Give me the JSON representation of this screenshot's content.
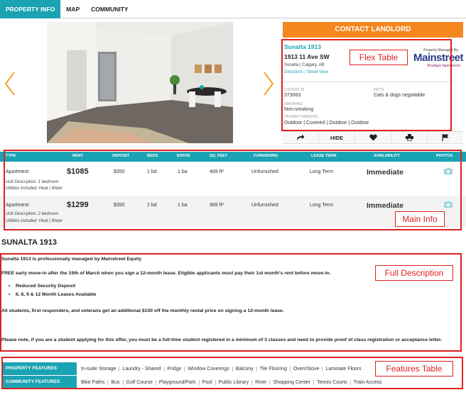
{
  "tabs": [
    {
      "label": "PROPERTY INFO",
      "active": true
    },
    {
      "label": "MAP",
      "active": false
    },
    {
      "label": "COMMUNITY",
      "active": false
    }
  ],
  "contact_button": "CONTACT LANDLORD",
  "property": {
    "name": "Sunalta 1913",
    "address": "1913 11 Ave SW",
    "city": "Sunalta | Calgary, AB",
    "links": [
      "Directions",
      "Street View"
    ],
    "managed_by_label": "Property Managed By:",
    "manager_logo_main": "Mainstreet",
    "manager_logo_sub": "Boutique Apartments"
  },
  "details": {
    "listing_id_label": "LISTING ID",
    "listing_id": "373063",
    "pets_label": "PETS",
    "pets": "Cats & dogs negotiable",
    "smoking_label": "SMOKING",
    "smoking": "Non-smoking",
    "parking_label": "TENANT PARKING",
    "parking": "Outdoor | Covered | Outdoor | Outdoor"
  },
  "actions": {
    "share": "share-icon",
    "hide": "HIDE",
    "favorite": "heart-icon",
    "print": "print-icon",
    "report": "flag-icon"
  },
  "annotations": {
    "flex": "Flex Table",
    "main": "Main Info",
    "full": "Full Description",
    "features": "Features Table"
  },
  "table": {
    "headers": [
      "TYPE",
      "RENT",
      "DEPOSIT",
      "BEDS",
      "BATHS",
      "SQ. FEET",
      "FURNISHING",
      "LEASE TERM",
      "AVAILABILITY",
      "PHOTOS"
    ],
    "rows": [
      {
        "type": "Apartment",
        "rent": "$1085",
        "deposit": "$350",
        "beds": "1 bd",
        "baths": "1 ba",
        "sqft": "489 ft²",
        "furnishing": "Unfurnished",
        "lease": "Long Term",
        "availability": "Immediate",
        "desc": "Unit Description: 1 bedroom",
        "utilities": "Utilities included: Heat | Water"
      },
      {
        "type": "Apartment",
        "rent": "$1299",
        "deposit": "$350",
        "beds": "2 bd",
        "baths": "1 ba",
        "sqft": "989 ft²",
        "furnishing": "Unfurnished",
        "lease": "Long Term",
        "availability": "Immediate",
        "desc": "Unit Description: 2 bedroom",
        "utilities": "Utilities included: Heat | Water"
      }
    ]
  },
  "description": {
    "title": "SUNALTA 1913",
    "managed": "Sunalta 1913 is professionally managed by Mainstreet Equity",
    "promo": "FREE early move-in after the 19th of March when you sign a 12-month lease. Eligible applicants must pay their 1st month's rent before move-in.",
    "bullets": [
      "Reduced Security Deposit",
      "6, 8, 9 & 12 Month Leases Available"
    ],
    "discount": "All students, first responders, and veterans get an additional $100 off the monthly rental price on signing a 12-month lease.",
    "note": "Please note, if you are a student applying for this offer, you must be a full-time student registered in a minimum of 3 classes and need to provide proof of class registration or acceptance letter."
  },
  "features": {
    "property_label": "PROPERTY FEATURES",
    "property": [
      "In-suite Storage",
      "Laundry - Shared",
      "Fridge",
      "Window Coverings",
      "Balcony",
      "Tile Flooring",
      "Oven/Stove",
      "Laminate Floors"
    ],
    "community_label": "COMMUNITY FEATURES",
    "community": [
      "Bike Paths",
      "Bus",
      "Golf Course",
      "Playground/Park",
      "Pool",
      "Public Library",
      "River",
      "Shopping Center",
      "Tennis Courts",
      "Train Access"
    ]
  }
}
